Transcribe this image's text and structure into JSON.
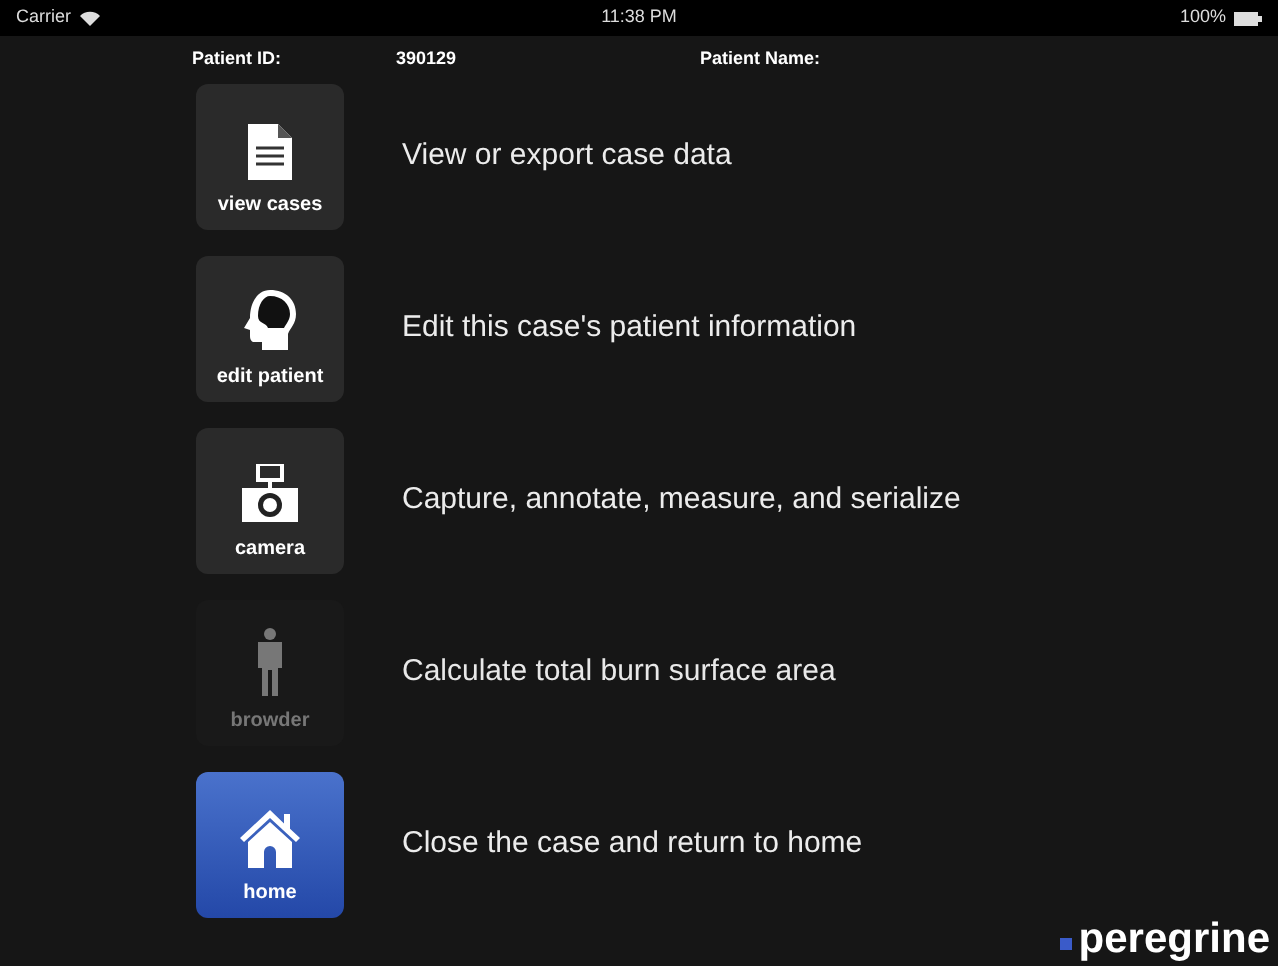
{
  "status_bar": {
    "carrier": "Carrier",
    "time": "11:38 PM",
    "battery": "100%"
  },
  "header": {
    "patient_id_label": "Patient ID:",
    "patient_id": "390129",
    "patient_name_label": "Patient Name:"
  },
  "actions": [
    {
      "kind": "document",
      "label": "view cases",
      "description": "View or export case data",
      "disabled": false,
      "selected": false
    },
    {
      "kind": "head",
      "label": "edit patient",
      "description": "Edit this case's patient information",
      "disabled": false,
      "selected": false
    },
    {
      "kind": "camera",
      "label": "camera",
      "description": "Capture, annotate, measure, and serialize",
      "disabled": false,
      "selected": false
    },
    {
      "kind": "person",
      "label": "browder",
      "description": "Calculate total burn surface area",
      "disabled": true,
      "selected": false
    },
    {
      "kind": "house",
      "label": "home",
      "description": "Close the case and return to home",
      "disabled": false,
      "selected": true
    }
  ],
  "brand": "peregrine"
}
